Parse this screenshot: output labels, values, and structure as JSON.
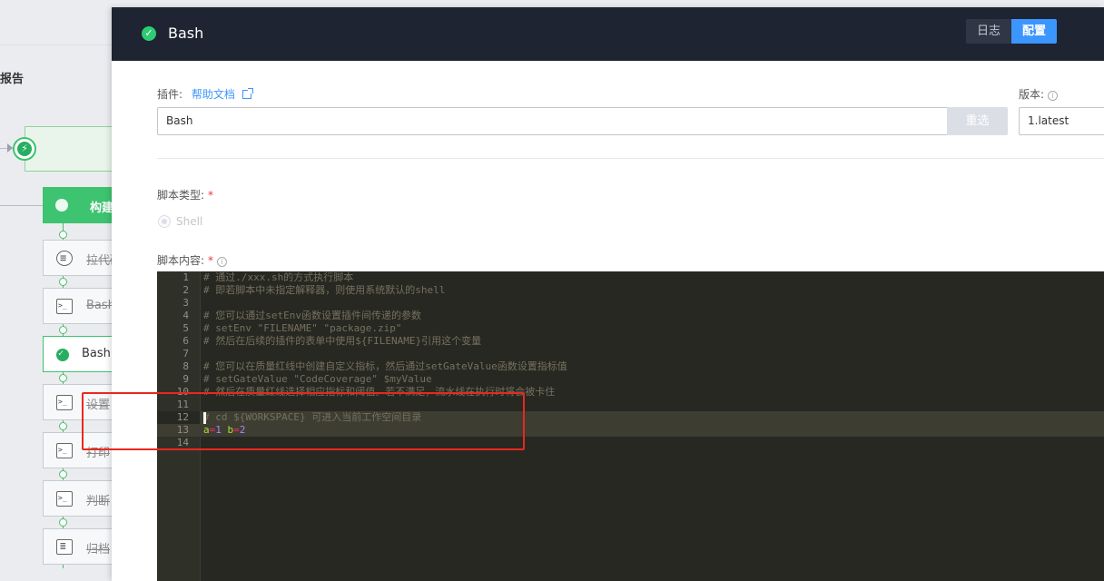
{
  "background": {
    "report_label": "报告",
    "stage_label": "构建",
    "jobs": [
      {
        "label": "拉代码",
        "icon": "code-pull-icon"
      },
      {
        "label": "Bash",
        "icon": "terminal-icon"
      },
      {
        "label": "Bash",
        "icon": "check-circle-icon",
        "active": true
      },
      {
        "label": "设置",
        "icon": "terminal-icon"
      },
      {
        "label": "打印",
        "icon": "terminal-icon"
      },
      {
        "label": "判断",
        "icon": "terminal-icon"
      },
      {
        "label": "归档",
        "icon": "clipboard-icon"
      }
    ]
  },
  "panel": {
    "title": "Bash",
    "tabs": {
      "log": "日志",
      "config": "配置"
    },
    "plugin_label": "插件:",
    "help_link": "帮助文档",
    "plugin_value": "Bash",
    "reselect_label": "重选",
    "version_label": "版本:",
    "version_value": "1.latest",
    "script_type_label": "脚本类型:",
    "script_type_option": "Shell",
    "script_content_label": "脚本内容:",
    "required_mark": "*"
  },
  "editor": {
    "line_numbers": [
      "1",
      "2",
      "3",
      "4",
      "5",
      "6",
      "7",
      "8",
      "9",
      "10",
      "11",
      "12",
      "13",
      "14"
    ],
    "lines": [
      "# 通过./xxx.sh的方式执行脚本",
      "# 即若脚本中未指定解释器，则使用系统默认的shell",
      "",
      "# 您可以通过setEnv函数设置插件间传递的参数",
      "# setEnv \"FILENAME\" \"package.zip\"",
      "# 然后在后续的插件的表单中使用${FILENAME}引用这个变量",
      "",
      "# 您可以在质量红线中创建自定义指标，然后通过setGateValue函数设置指标值",
      "# setGateValue \"CodeCoverage\" $myValue",
      "# 然后在质量红线选择相应指标和阈值。若不满足，流水线在执行时将会被卡住",
      "",
      "# cd ${WORKSPACE} 可进入当前工作空间目录",
      "a=1 b=2",
      ""
    ],
    "line13_tokens": {
      "a": "a",
      "eq": "=",
      "one": "1",
      "space": " ",
      "b": "b",
      "two": "2"
    }
  }
}
